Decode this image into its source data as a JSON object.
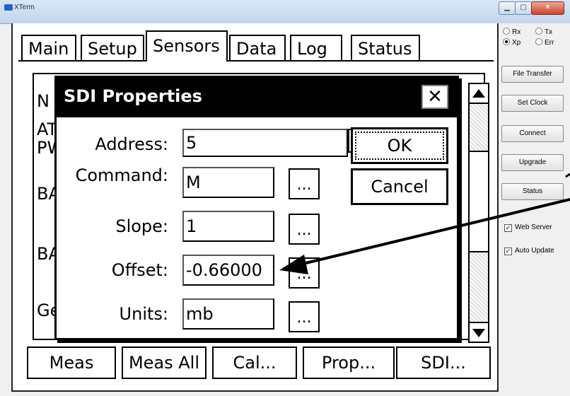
{
  "window": {
    "title": "XTerm"
  },
  "tabs": [
    "Main",
    "Setup",
    "Sensors",
    "Data",
    "Log",
    "Status"
  ],
  "active_tab": "Sensors",
  "list": {
    "items": [
      "N",
      "AT",
      "PW",
      "BA",
      "BA",
      "Ge"
    ]
  },
  "bottom_buttons": [
    "Meas",
    "Meas All",
    "Cal...",
    "Prop...",
    "SDI..."
  ],
  "dialog": {
    "title": "SDI Properties",
    "close_label": "✕",
    "fields": {
      "address": {
        "label": "Address:",
        "value": "5"
      },
      "command": {
        "label": "Command:",
        "value": "M"
      },
      "slope": {
        "label": "Slope:",
        "value": "1"
      },
      "offset": {
        "label": "Offset:",
        "value": "-0.66000"
      },
      "units": {
        "label": "Units:",
        "value": "mb"
      }
    },
    "ellipsis_label": "...",
    "ok_label": "OK",
    "cancel_label": "Cancel"
  },
  "side_panel": {
    "radios": [
      {
        "label": "Rx",
        "selected": false
      },
      {
        "label": "Tx",
        "selected": false
      },
      {
        "label": "Xp",
        "selected": true
      },
      {
        "label": "Err",
        "selected": false
      }
    ],
    "buttons": [
      "File Transfer",
      "Set Clock",
      "Connect",
      "Upgrade",
      "Status"
    ],
    "checks": [
      {
        "label": "Web Server",
        "checked": true
      },
      {
        "label": "Auto Update",
        "checked": true
      }
    ]
  }
}
